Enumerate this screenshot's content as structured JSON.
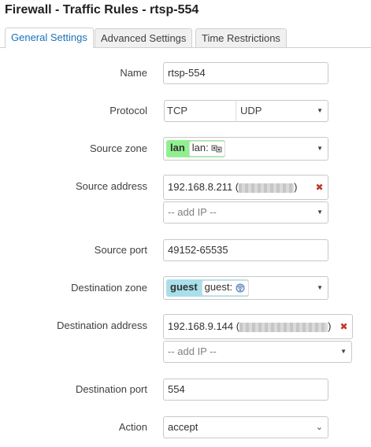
{
  "page_title": "Firewall - Traffic Rules - rtsp-554",
  "tabs": [
    {
      "label": "General Settings",
      "active": true
    },
    {
      "label": "Advanced Settings",
      "active": false
    },
    {
      "label": "Time Restrictions",
      "active": false
    }
  ],
  "form": {
    "name": {
      "label": "Name",
      "value": "rtsp-554"
    },
    "protocol": {
      "label": "Protocol",
      "values": [
        "TCP",
        "UDP"
      ]
    },
    "source_zone": {
      "label": "Source zone",
      "zone": "lan",
      "iface": "lan:",
      "zone_color": "#90f090"
    },
    "source_address": {
      "label": "Source address",
      "value_prefix": "192.168.8.211 (",
      "value_suffix": ")",
      "add_placeholder": "-- add IP --"
    },
    "source_port": {
      "label": "Source port",
      "value": "49152-65535"
    },
    "destination_zone": {
      "label": "Destination zone",
      "zone": "guest",
      "iface": "guest:",
      "zone_color": "#a8dfea"
    },
    "destination_address": {
      "label": "Destination address",
      "value_prefix": "192.168.9.144 (",
      "value_suffix": ")",
      "add_placeholder": "-- add IP --"
    },
    "destination_port": {
      "label": "Destination port",
      "value": "554"
    },
    "action": {
      "label": "Action",
      "value": "accept"
    }
  },
  "icons": {
    "remove": "close-icon",
    "dropdown": "chevron-down-icon",
    "lan_iface": "network-interfaces-icon",
    "guest_iface": "wireless-icon"
  },
  "colors": {
    "tab_active_text": "#1a73b8",
    "remove_x": "#c0392b"
  }
}
